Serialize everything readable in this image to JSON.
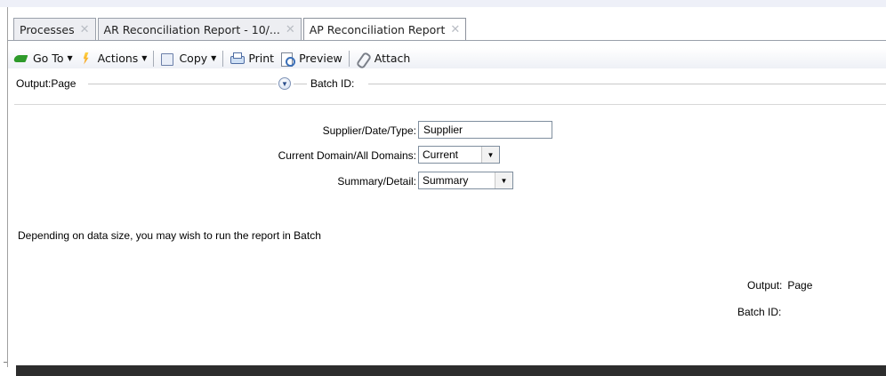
{
  "tabs": [
    {
      "label": "Processes",
      "close": "✕"
    },
    {
      "label": "AR Reconciliation Report - 10/...",
      "close": "✕"
    },
    {
      "label": "AP Reconciliation Report",
      "close": "✕"
    }
  ],
  "toolbar": {
    "goto": "Go To",
    "actions": "Actions",
    "copy": "Copy",
    "print": "Print",
    "preview": "Preview",
    "attach": "Attach",
    "caret": "▼"
  },
  "output_bar": {
    "label": "Output:Page",
    "toggle": "▼",
    "batch": "Batch ID:"
  },
  "form": {
    "supplier_date_type_label": "Supplier/Date/Type:",
    "supplier_date_type_value": "Supplier",
    "domain_label": "Current Domain/All Domains:",
    "domain_value": "Current",
    "summary_label": "Summary/Detail:",
    "summary_value": "Summary",
    "dropdown_arrow": "▼"
  },
  "note": "Depending on data size, you may wish to run the report in Batch",
  "summary_panel": {
    "output_label": "Output:",
    "output_value": "Page",
    "batch_label": "Batch ID:"
  }
}
